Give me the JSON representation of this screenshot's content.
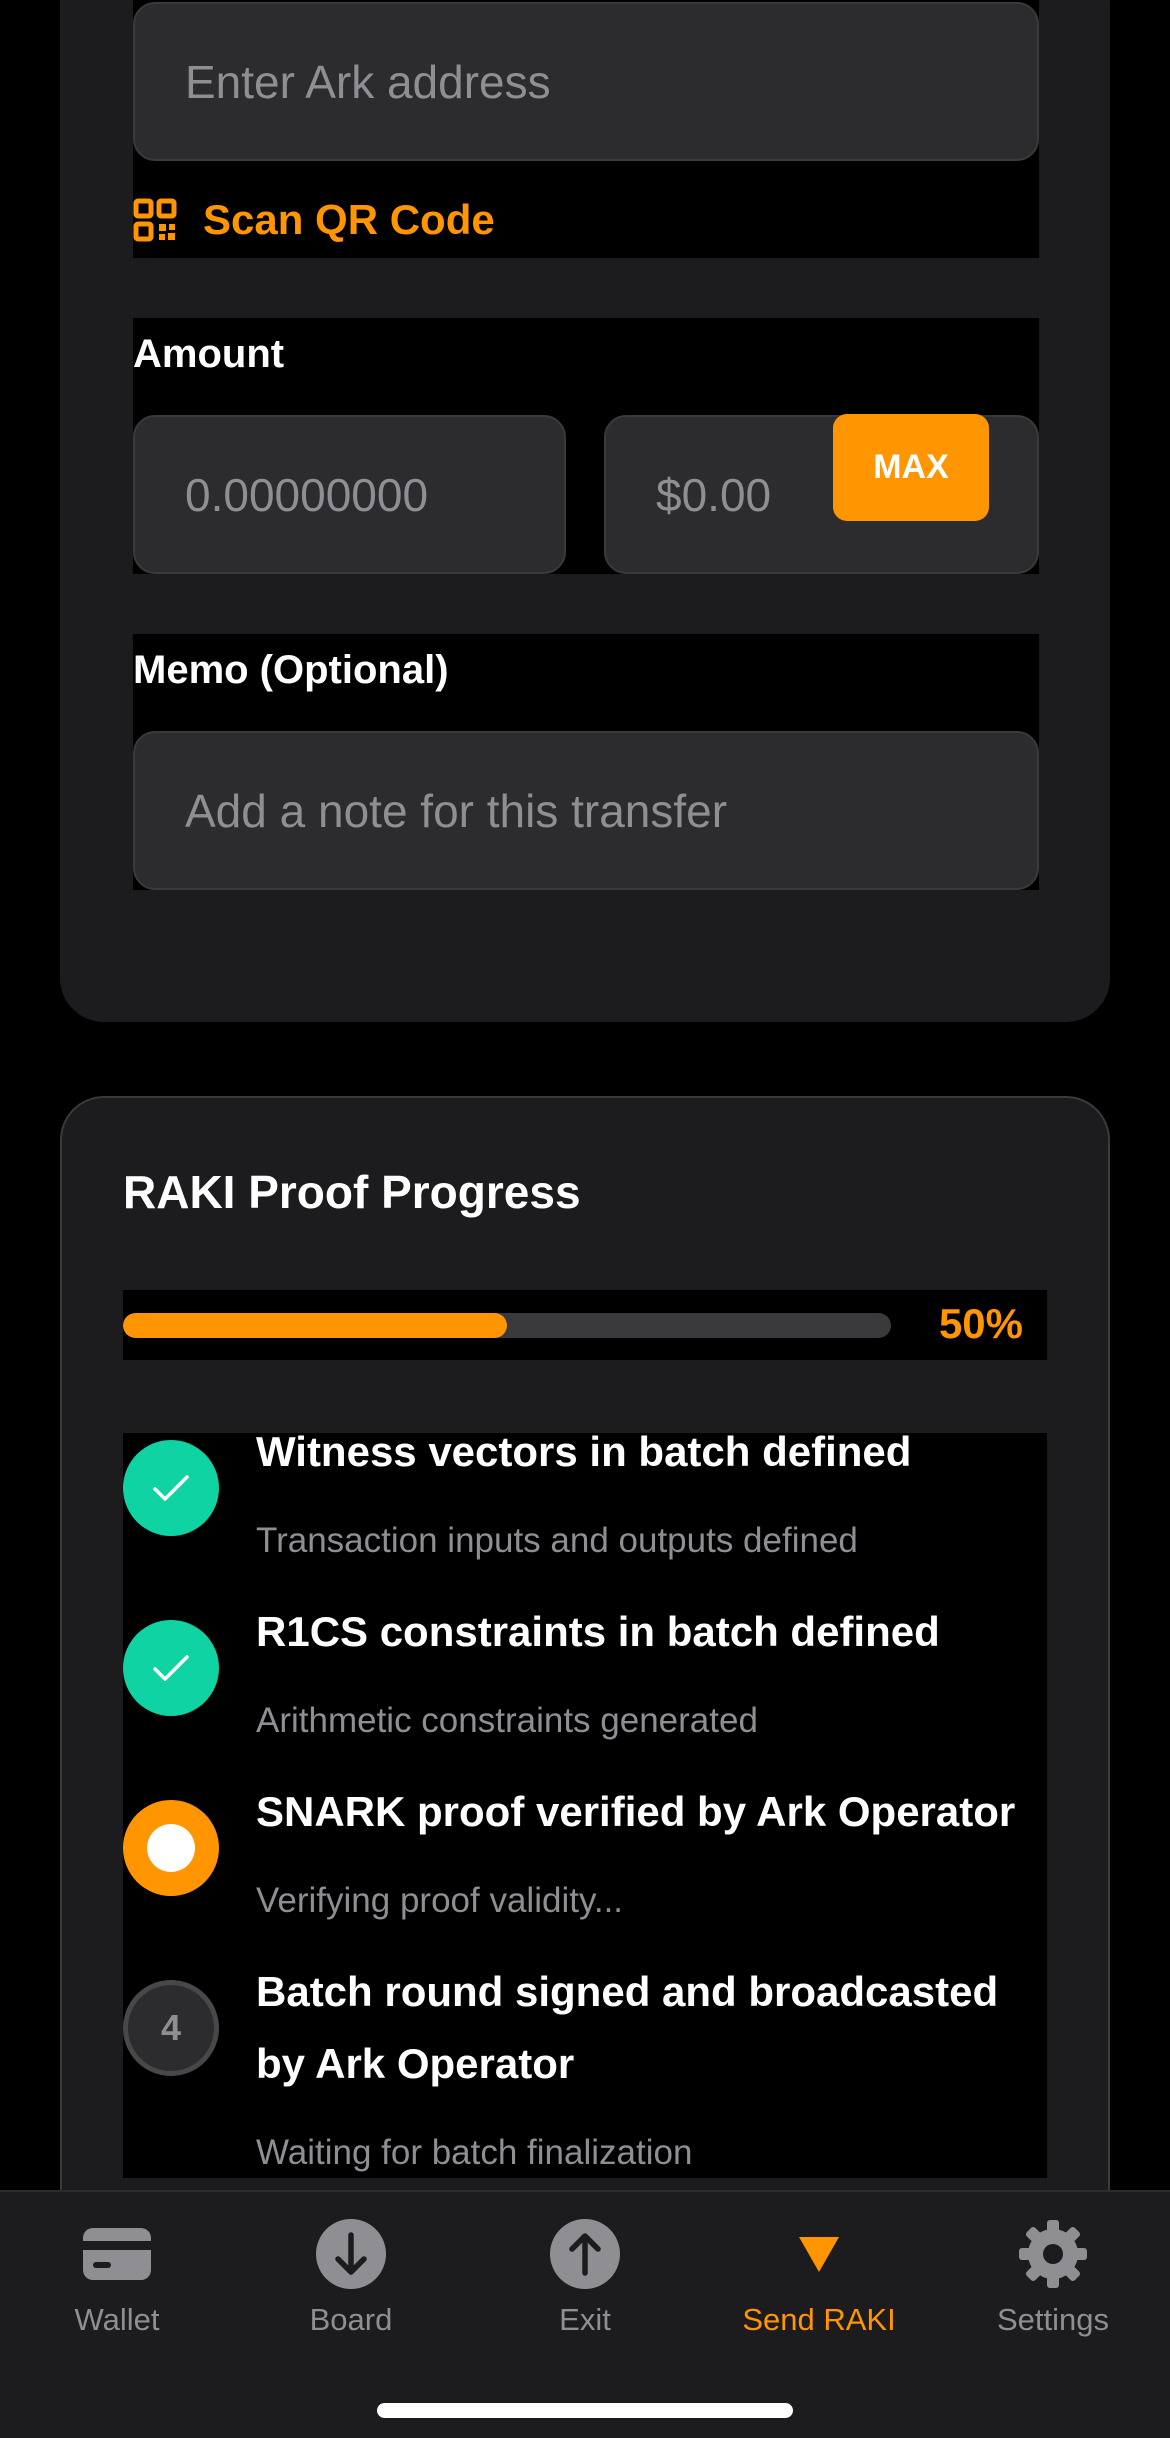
{
  "form": {
    "recipient_placeholder": "Enter Ark address",
    "scan_label": "Scan QR Code",
    "amount_label": "Amount",
    "amount_placeholder": "0.00000000",
    "usd_placeholder": "$0.00",
    "max_label": "MAX",
    "memo_label": "Memo (Optional)",
    "memo_placeholder": "Add a note for this transfer"
  },
  "progress": {
    "title": "RAKI Proof Progress",
    "percent_label": "50%",
    "percent_value": 50,
    "steps": [
      {
        "status": "done",
        "title": "Witness vectors in batch defined",
        "subtitle": "Transaction inputs and outputs defined"
      },
      {
        "status": "done",
        "title": "R1CS constraints in batch defined",
        "subtitle": "Arithmetic constraints generated"
      },
      {
        "status": "active",
        "title": "SNARK proof verified by Ark Operator",
        "subtitle": "Verifying proof validity..."
      },
      {
        "status": "pending",
        "number": "4",
        "title": "Batch round signed and broadcasted by Ark Operator",
        "subtitle": "Waiting for batch finalization"
      }
    ]
  },
  "tabs": [
    {
      "label": "Wallet",
      "icon": "wallet-icon"
    },
    {
      "label": "Board",
      "icon": "arrow-down-circle-icon"
    },
    {
      "label": "Exit",
      "icon": "arrow-up-circle-icon"
    },
    {
      "label": "Send RAKI",
      "icon": "triangle-down-icon",
      "active": true
    },
    {
      "label": "Settings",
      "icon": "gear-icon"
    }
  ],
  "colors": {
    "accent": "#ff9500",
    "success": "#10d3a3",
    "card": "#1c1c1e",
    "field": "#2c2c2e"
  }
}
